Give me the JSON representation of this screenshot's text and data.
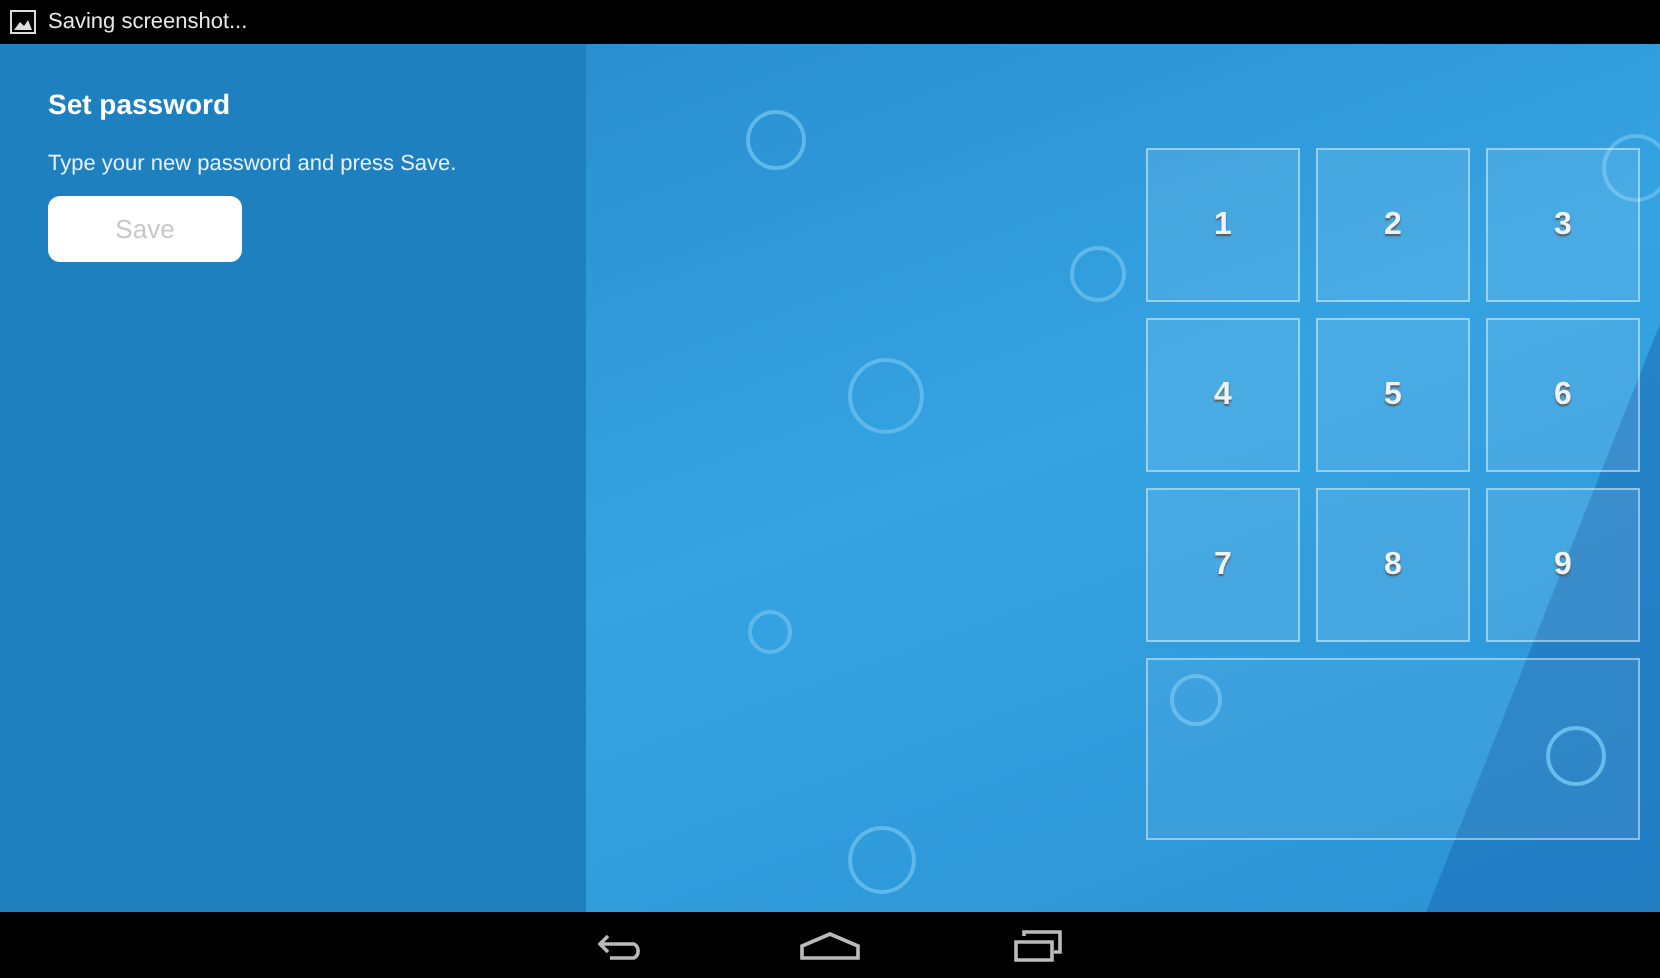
{
  "status_bar": {
    "notification": "Saving screenshot..."
  },
  "panel": {
    "title": "Set password",
    "instruction": "Type your new password and press Save.",
    "save_button": {
      "label": "Save",
      "disabled": true
    }
  },
  "keypad": {
    "keys": [
      "1",
      "2",
      "3",
      "4",
      "5",
      "6",
      "7",
      "8",
      "9"
    ]
  },
  "nav_bar": {
    "buttons": [
      {
        "kind": "back"
      },
      {
        "kind": "home"
      },
      {
        "kind": "recents"
      }
    ]
  }
}
